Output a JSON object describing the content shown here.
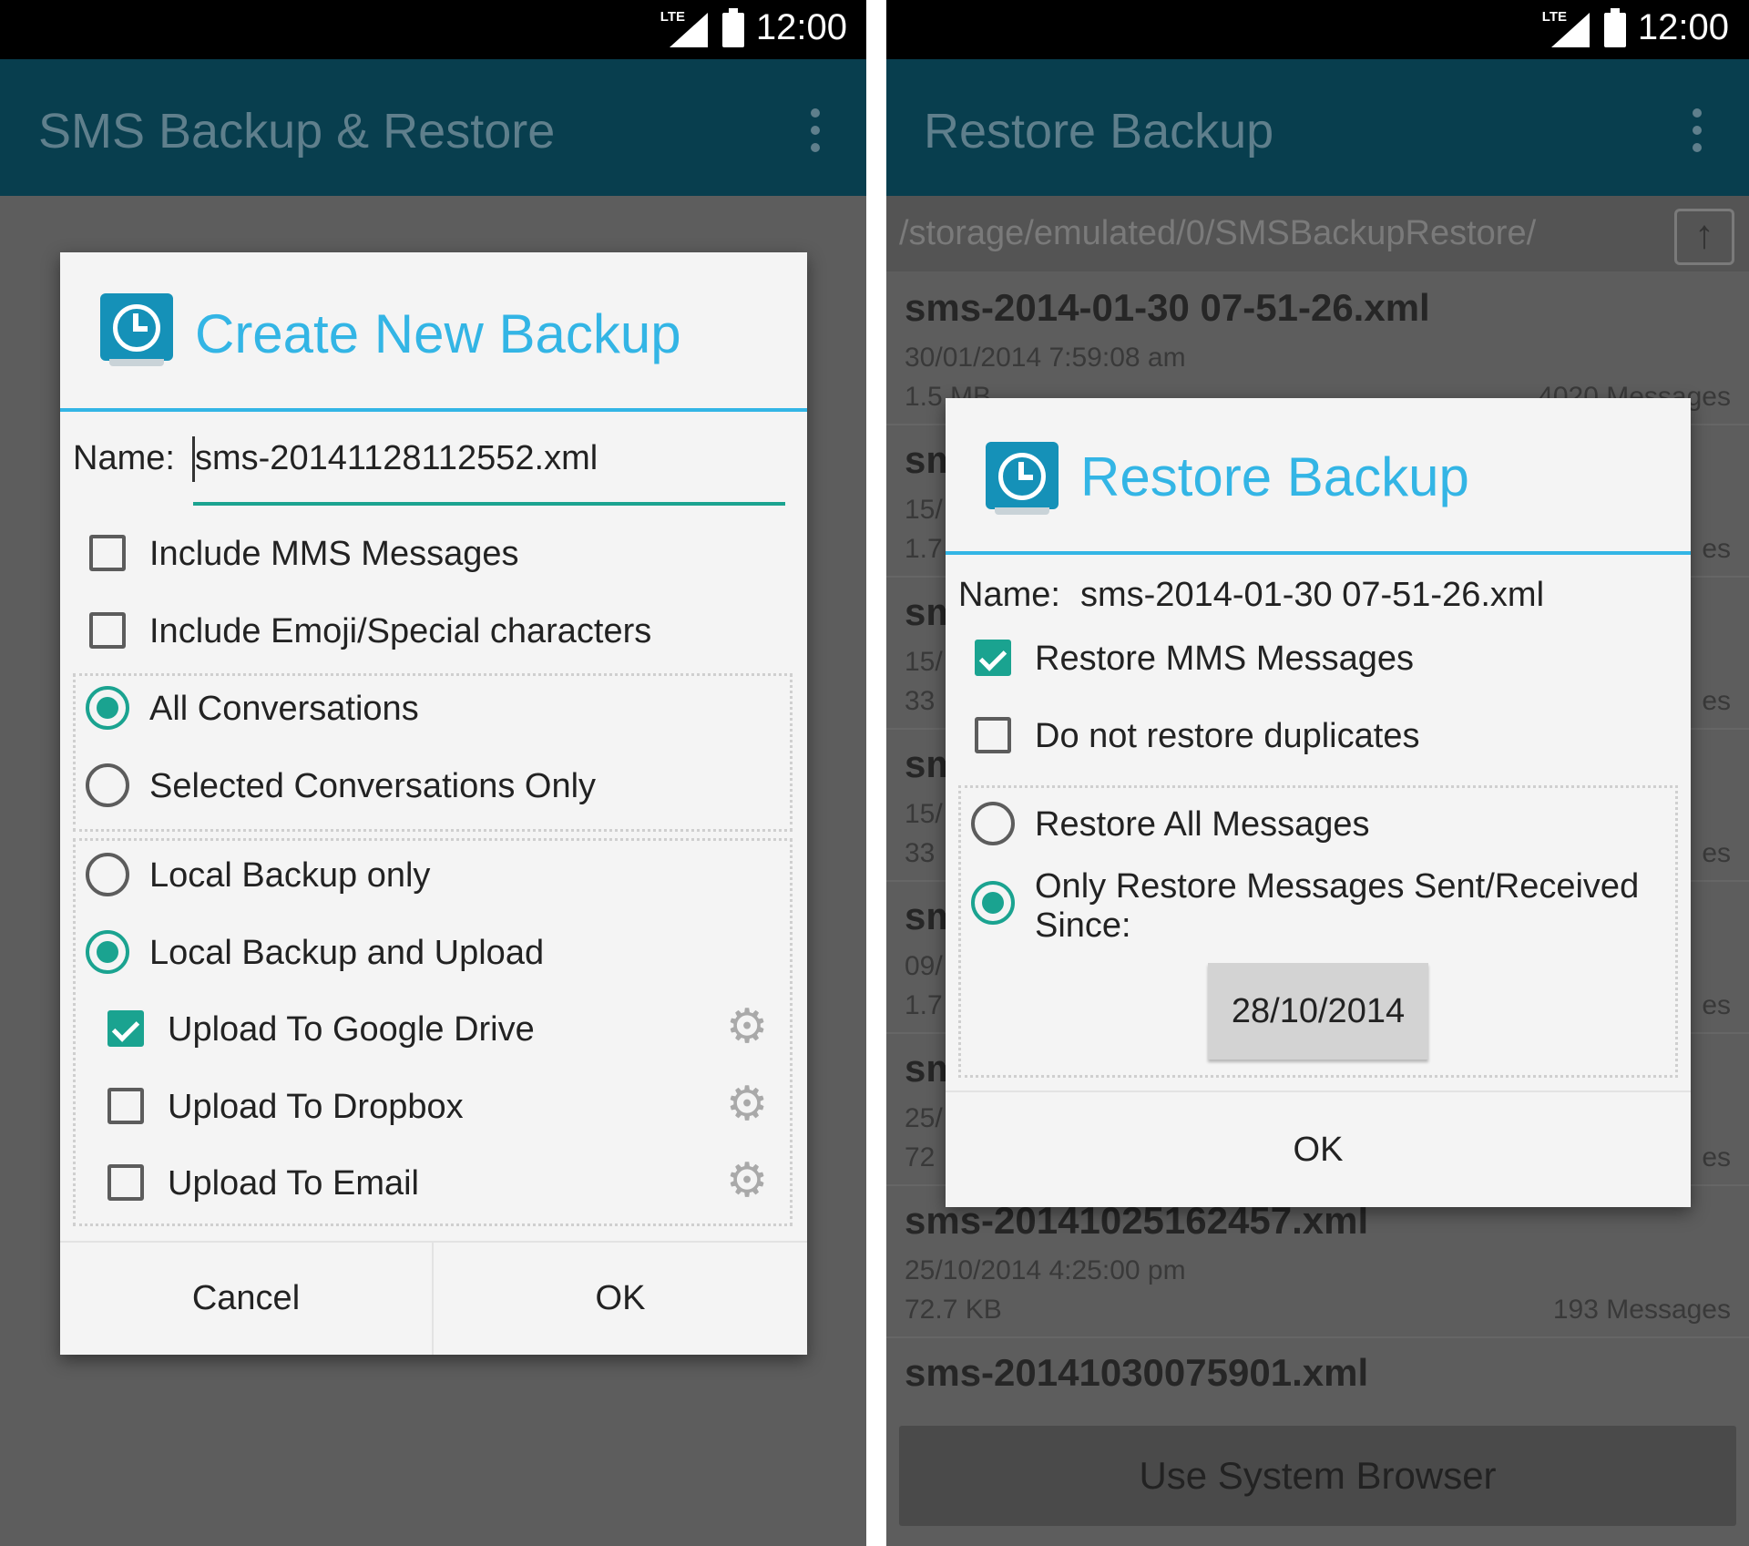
{
  "left": {
    "status": {
      "network": "LTE",
      "time": "12:00"
    },
    "app_title": "SMS Backup & Restore",
    "dialog": {
      "title": "Create New Backup",
      "name_label": "Name:",
      "name_value": "sms-20141128112552.xml",
      "include_mms": {
        "label": "Include MMS Messages",
        "checked": false
      },
      "include_emoji": {
        "label": "Include Emoji/Special characters",
        "checked": false
      },
      "conversations": [
        {
          "label": "All Conversations",
          "selected": true
        },
        {
          "label": "Selected Conversations Only",
          "selected": false
        }
      ],
      "backup_mode": [
        {
          "label": "Local Backup only",
          "selected": false
        },
        {
          "label": "Local Backup and Upload",
          "selected": true
        }
      ],
      "uploads": [
        {
          "label": "Upload To Google Drive",
          "checked": true,
          "icon": "gear-icon"
        },
        {
          "label": "Upload To Dropbox",
          "checked": false,
          "icon": "gear-icon"
        },
        {
          "label": "Upload To Email",
          "checked": false,
          "icon": "gear-icon"
        }
      ],
      "cancel_label": "Cancel",
      "ok_label": "OK"
    }
  },
  "right": {
    "status": {
      "network": "LTE",
      "time": "12:00"
    },
    "app_title": "Restore Backup",
    "path": "/storage/emulated/0/SMSBackupRestore/",
    "files": [
      {
        "name": "sms-2014-01-30 07-51-26.xml",
        "date": "30/01/2014 7:59:08 am",
        "size": "1.5 MB",
        "count": "4020 Messages"
      },
      {
        "name": "sm",
        "date": "15/",
        "size": "1.7",
        "count": "es"
      },
      {
        "name": "sm",
        "date": "15/",
        "size": "33",
        "count": "es"
      },
      {
        "name": "sm",
        "date": "15/",
        "size": "33",
        "count": "es"
      },
      {
        "name": "sm",
        "date": "09/",
        "size": "1.7",
        "count": "es"
      },
      {
        "name": "sm",
        "date": "25/",
        "size": "72",
        "count": "es"
      },
      {
        "name": "sms-20141025162457.xml",
        "date": "25/10/2014 4:25:00 pm",
        "size": "72.7 KB",
        "count": "193 Messages"
      },
      {
        "name": "sms-20141030075901.xml",
        "date": "",
        "size": "",
        "count": ""
      }
    ],
    "system_browser_label": "Use System Browser",
    "dialog": {
      "title": "Restore Backup",
      "name_label": "Name:",
      "name_value": "sms-2014-01-30 07-51-26.xml",
      "restore_mms": {
        "label": "Restore MMS Messages",
        "checked": true
      },
      "no_duplicates": {
        "label": "Do not restore duplicates",
        "checked": false
      },
      "restore_all": {
        "label": "Restore All Messages",
        "selected": false
      },
      "restore_since": {
        "label_line1": "Only Restore Messages Sent/Received",
        "label_line2": "Since:",
        "selected": true
      },
      "since_date": "28/10/2014",
      "ok_label": "OK"
    }
  }
}
